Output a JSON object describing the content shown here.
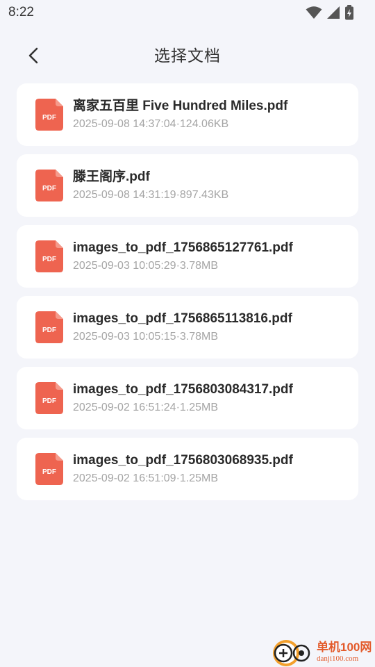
{
  "status_bar": {
    "time": "8:22"
  },
  "header": {
    "title": "选择文档"
  },
  "files": [
    {
      "name": "离家五百里 Five Hundred Miles.pdf",
      "meta": "2025-09-08 14:37:04·124.06KB",
      "icon_label": "PDF"
    },
    {
      "name": "滕王阁序.pdf",
      "meta": "2025-09-08 14:31:19·897.43KB",
      "icon_label": "PDF"
    },
    {
      "name": "images_to_pdf_1756865127761.pdf",
      "meta": "2025-09-03 10:05:29·3.78MB",
      "icon_label": "PDF"
    },
    {
      "name": "images_to_pdf_1756865113816.pdf",
      "meta": "2025-09-03 10:05:15·3.78MB",
      "icon_label": "PDF"
    },
    {
      "name": "images_to_pdf_1756803084317.pdf",
      "meta": "2025-09-02 16:51:24·1.25MB",
      "icon_label": "PDF"
    },
    {
      "name": "images_to_pdf_1756803068935.pdf",
      "meta": "2025-09-02 16:51:09·1.25MB",
      "icon_label": "PDF"
    }
  ],
  "watermark": {
    "name": "单机100网",
    "url": "danji100.com"
  },
  "colors": {
    "pdf_red": "#ee6450",
    "background": "#f4f5fa",
    "card": "#ffffff",
    "watermark": "#e35a2a"
  },
  "icons": {
    "back": "chevron-left-icon",
    "wifi": "wifi-icon",
    "signal": "signal-icon",
    "battery": "battery-icon",
    "file": "pdf-file-icon"
  }
}
